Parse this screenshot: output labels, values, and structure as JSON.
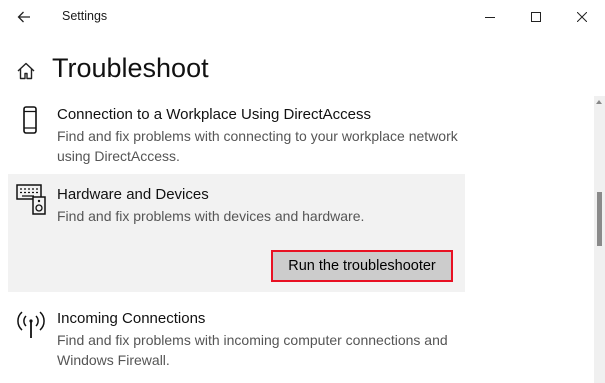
{
  "window": {
    "title": "Settings",
    "back_icon": "arrow-left-icon",
    "controls": [
      "minimize-icon",
      "maximize-icon",
      "close-icon"
    ]
  },
  "page": {
    "title": "Troubleshoot",
    "home_icon": "home-icon"
  },
  "items": [
    {
      "icon": "phone-device-icon",
      "name": "Connection to a Workplace Using DirectAccess",
      "description": "Find and fix problems with connecting to your workplace network using DirectAccess."
    },
    {
      "icon": "keyboard-speaker-icon",
      "name": "Hardware and Devices",
      "description": "Find and fix problems with devices and hardware.",
      "selected": true,
      "action_label": "Run the troubleshooter"
    },
    {
      "icon": "antenna-icon",
      "name": "Incoming Connections",
      "description": "Find and fix problems with incoming computer connections and Windows Firewall."
    }
  ],
  "colors": {
    "highlight_border": "#e81123",
    "button_bg": "#cccccc",
    "selected_bg": "#f2f2f2"
  }
}
